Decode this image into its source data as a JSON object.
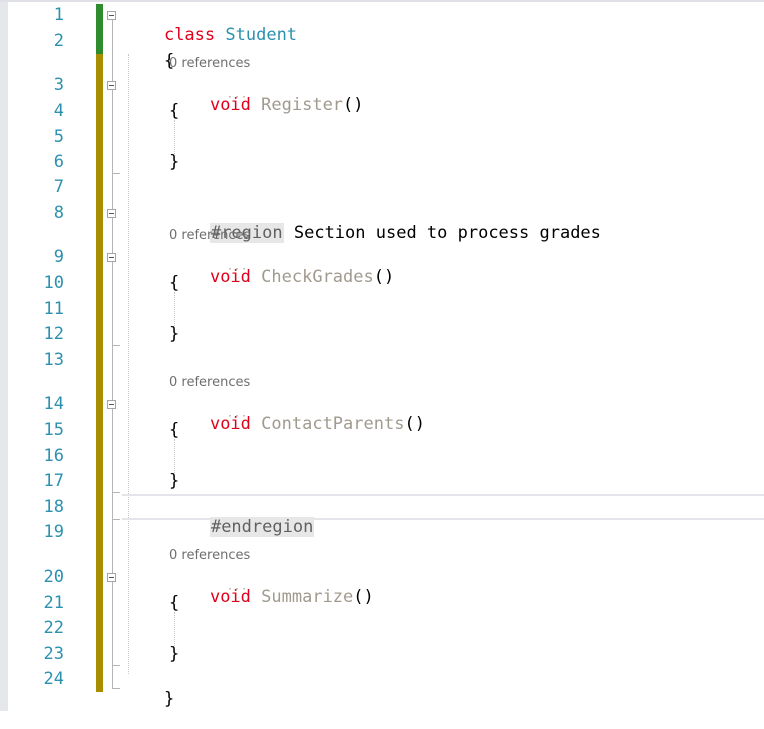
{
  "editor": {
    "language": "csharp",
    "line_numbers": [
      "1",
      "2",
      "3",
      "4",
      "5",
      "6",
      "7",
      "8",
      "9",
      "10",
      "11",
      "12",
      "13",
      "14",
      "15",
      "16",
      "17",
      "18",
      "19",
      "20",
      "21",
      "22",
      "23",
      "24"
    ],
    "codelens": {
      "register": "0 references",
      "check_grades": "0 references",
      "contact_parents": "0 references",
      "summarize": "0 references"
    },
    "code": {
      "class_kw": "class",
      "class_name": "Student",
      "open_brace": "{",
      "close_brace": "}",
      "void_kw": "void",
      "register_name": "Register",
      "check_grades_name": "CheckGrades",
      "contact_parents_name": "ContactParents",
      "summarize_name": "Summarize",
      "parens": "()",
      "region_directive": "#region",
      "region_text": "Section used to process grades",
      "endregion_directive": "#endregion"
    },
    "colors": {
      "keyword": "#e0001a",
      "type": "#2b91af",
      "unused_method": "#a19a8f",
      "line_number": "#2b91af",
      "saved_change_bar": "#2e8b2e",
      "unsaved_change_bar": "#a88d00"
    }
  }
}
